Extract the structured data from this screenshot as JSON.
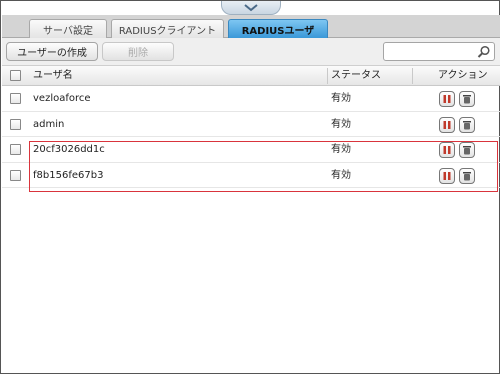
{
  "tabs": [
    {
      "label": "サーバ設定"
    },
    {
      "label": "RADIUSクライアント"
    },
    {
      "label": "RADIUSユーザ",
      "active": true
    }
  ],
  "toolbar": {
    "create_label": "ユーザーの作成",
    "delete_label": "削除",
    "search_value": "",
    "search_placeholder": ""
  },
  "table": {
    "headers": {
      "name": "ユーザ名",
      "status": "ステータス",
      "action": "アクション"
    },
    "rows": [
      {
        "name": "vezloaforce",
        "status": "有効"
      },
      {
        "name": "admin",
        "status": "有効"
      },
      {
        "name": "20cf3026dd1c",
        "status": "有効"
      },
      {
        "name": "f8b156fe67b3",
        "status": "有効"
      }
    ]
  },
  "colors": {
    "active_tab": "#3a98d8",
    "highlight": "#d9343c",
    "pause_icon": "#c0392b",
    "trash_icon": "#444444"
  }
}
